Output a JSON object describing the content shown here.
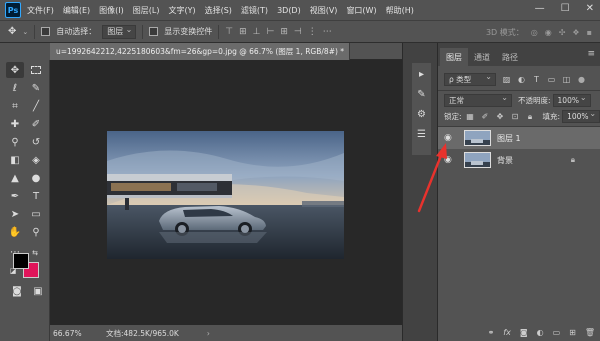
{
  "app": {
    "logo": "Ps"
  },
  "menubar": {
    "items": [
      "文件(F)",
      "编辑(E)",
      "图像(I)",
      "图层(L)",
      "文字(Y)",
      "选择(S)",
      "滤镜(T)",
      "3D(D)",
      "视图(V)",
      "窗口(W)",
      "帮助(H)"
    ],
    "window_controls": [
      "—",
      "☐",
      "✕"
    ]
  },
  "options": {
    "auto_select_label": "自动选择：",
    "auto_select_value": "图层",
    "show_transform_label": "显示变换控件",
    "mode_3d_label": "3D 模式："
  },
  "document": {
    "tab_title": "u=1992642212,4225180603&fm=26&gp=0.jpg @ 66.7% (图层 1, RGB/8#) *",
    "close_glyph": "×"
  },
  "status": {
    "zoom": "66.67%",
    "doc_size": "文档:482.5K/965.0K",
    "arrow": "›"
  },
  "colors": {
    "foreground": "#000000",
    "background": "#e0145a",
    "annotation_arrow": "#e8322d"
  },
  "layers_panel": {
    "tabs": [
      "图层",
      "通道",
      "路径"
    ],
    "filter_label": "ρ 类型",
    "blend_mode": "正常",
    "opacity_label": "不透明度:",
    "opacity_value": "100%",
    "lock_label": "锁定:",
    "fill_label": "填充:",
    "fill_value": "100%",
    "layers": [
      {
        "name": "图层 1",
        "selected": true,
        "locked": false
      },
      {
        "name": "背景",
        "selected": false,
        "locked": true
      }
    ]
  },
  "icons": {
    "eye": "eye-icon",
    "lock": "lock-icon",
    "move": "move-tool-icon"
  }
}
